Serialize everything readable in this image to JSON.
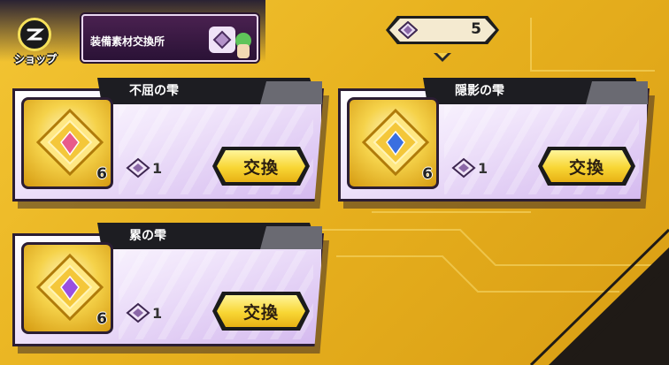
{
  "shop": {
    "label": "ショップ"
  },
  "banner": {
    "title": "装備素材交換所"
  },
  "currency": {
    "count": "5"
  },
  "cards": [
    {
      "name": "不屈の雫",
      "count": "6",
      "cost": "1",
      "button": "交換",
      "gem_color": "#e85a8a"
    },
    {
      "name": "隠影の雫",
      "count": "6",
      "cost": "1",
      "button": "交換",
      "gem_color": "#3a6fe0"
    },
    {
      "name": "累の雫",
      "count": "6",
      "cost": "1",
      "button": "交換",
      "gem_color": "#9a4fe0"
    }
  ]
}
